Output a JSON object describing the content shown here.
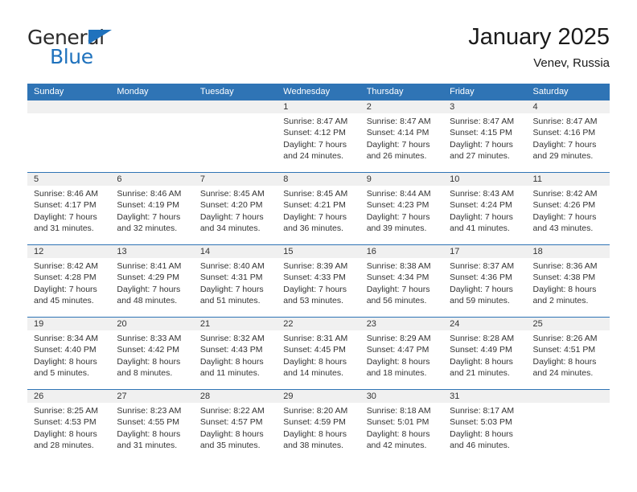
{
  "brand": {
    "name_part1": "General",
    "name_part2": "Blue",
    "accent_color": "#1f72bd"
  },
  "header": {
    "title": "January 2025",
    "subtitle": "Venev, Russia"
  },
  "theme": {
    "header_blue": "#2f74b5",
    "daynum_band": "#f0f0f0",
    "text": "#333333"
  },
  "weekdays": [
    "Sunday",
    "Monday",
    "Tuesday",
    "Wednesday",
    "Thursday",
    "Friday",
    "Saturday"
  ],
  "weeks": [
    [
      {
        "day": "",
        "lines": []
      },
      {
        "day": "",
        "lines": []
      },
      {
        "day": "",
        "lines": []
      },
      {
        "day": "1",
        "lines": [
          "Sunrise: 8:47 AM",
          "Sunset: 4:12 PM",
          "Daylight: 7 hours",
          "and 24 minutes."
        ]
      },
      {
        "day": "2",
        "lines": [
          "Sunrise: 8:47 AM",
          "Sunset: 4:14 PM",
          "Daylight: 7 hours",
          "and 26 minutes."
        ]
      },
      {
        "day": "3",
        "lines": [
          "Sunrise: 8:47 AM",
          "Sunset: 4:15 PM",
          "Daylight: 7 hours",
          "and 27 minutes."
        ]
      },
      {
        "day": "4",
        "lines": [
          "Sunrise: 8:47 AM",
          "Sunset: 4:16 PM",
          "Daylight: 7 hours",
          "and 29 minutes."
        ]
      }
    ],
    [
      {
        "day": "5",
        "lines": [
          "Sunrise: 8:46 AM",
          "Sunset: 4:17 PM",
          "Daylight: 7 hours",
          "and 31 minutes."
        ]
      },
      {
        "day": "6",
        "lines": [
          "Sunrise: 8:46 AM",
          "Sunset: 4:19 PM",
          "Daylight: 7 hours",
          "and 32 minutes."
        ]
      },
      {
        "day": "7",
        "lines": [
          "Sunrise: 8:45 AM",
          "Sunset: 4:20 PM",
          "Daylight: 7 hours",
          "and 34 minutes."
        ]
      },
      {
        "day": "8",
        "lines": [
          "Sunrise: 8:45 AM",
          "Sunset: 4:21 PM",
          "Daylight: 7 hours",
          "and 36 minutes."
        ]
      },
      {
        "day": "9",
        "lines": [
          "Sunrise: 8:44 AM",
          "Sunset: 4:23 PM",
          "Daylight: 7 hours",
          "and 39 minutes."
        ]
      },
      {
        "day": "10",
        "lines": [
          "Sunrise: 8:43 AM",
          "Sunset: 4:24 PM",
          "Daylight: 7 hours",
          "and 41 minutes."
        ]
      },
      {
        "day": "11",
        "lines": [
          "Sunrise: 8:42 AM",
          "Sunset: 4:26 PM",
          "Daylight: 7 hours",
          "and 43 minutes."
        ]
      }
    ],
    [
      {
        "day": "12",
        "lines": [
          "Sunrise: 8:42 AM",
          "Sunset: 4:28 PM",
          "Daylight: 7 hours",
          "and 45 minutes."
        ]
      },
      {
        "day": "13",
        "lines": [
          "Sunrise: 8:41 AM",
          "Sunset: 4:29 PM",
          "Daylight: 7 hours",
          "and 48 minutes."
        ]
      },
      {
        "day": "14",
        "lines": [
          "Sunrise: 8:40 AM",
          "Sunset: 4:31 PM",
          "Daylight: 7 hours",
          "and 51 minutes."
        ]
      },
      {
        "day": "15",
        "lines": [
          "Sunrise: 8:39 AM",
          "Sunset: 4:33 PM",
          "Daylight: 7 hours",
          "and 53 minutes."
        ]
      },
      {
        "day": "16",
        "lines": [
          "Sunrise: 8:38 AM",
          "Sunset: 4:34 PM",
          "Daylight: 7 hours",
          "and 56 minutes."
        ]
      },
      {
        "day": "17",
        "lines": [
          "Sunrise: 8:37 AM",
          "Sunset: 4:36 PM",
          "Daylight: 7 hours",
          "and 59 minutes."
        ]
      },
      {
        "day": "18",
        "lines": [
          "Sunrise: 8:36 AM",
          "Sunset: 4:38 PM",
          "Daylight: 8 hours",
          "and 2 minutes."
        ]
      }
    ],
    [
      {
        "day": "19",
        "lines": [
          "Sunrise: 8:34 AM",
          "Sunset: 4:40 PM",
          "Daylight: 8 hours",
          "and 5 minutes."
        ]
      },
      {
        "day": "20",
        "lines": [
          "Sunrise: 8:33 AM",
          "Sunset: 4:42 PM",
          "Daylight: 8 hours",
          "and 8 minutes."
        ]
      },
      {
        "day": "21",
        "lines": [
          "Sunrise: 8:32 AM",
          "Sunset: 4:43 PM",
          "Daylight: 8 hours",
          "and 11 minutes."
        ]
      },
      {
        "day": "22",
        "lines": [
          "Sunrise: 8:31 AM",
          "Sunset: 4:45 PM",
          "Daylight: 8 hours",
          "and 14 minutes."
        ]
      },
      {
        "day": "23",
        "lines": [
          "Sunrise: 8:29 AM",
          "Sunset: 4:47 PM",
          "Daylight: 8 hours",
          "and 18 minutes."
        ]
      },
      {
        "day": "24",
        "lines": [
          "Sunrise: 8:28 AM",
          "Sunset: 4:49 PM",
          "Daylight: 8 hours",
          "and 21 minutes."
        ]
      },
      {
        "day": "25",
        "lines": [
          "Sunrise: 8:26 AM",
          "Sunset: 4:51 PM",
          "Daylight: 8 hours",
          "and 24 minutes."
        ]
      }
    ],
    [
      {
        "day": "26",
        "lines": [
          "Sunrise: 8:25 AM",
          "Sunset: 4:53 PM",
          "Daylight: 8 hours",
          "and 28 minutes."
        ]
      },
      {
        "day": "27",
        "lines": [
          "Sunrise: 8:23 AM",
          "Sunset: 4:55 PM",
          "Daylight: 8 hours",
          "and 31 minutes."
        ]
      },
      {
        "day": "28",
        "lines": [
          "Sunrise: 8:22 AM",
          "Sunset: 4:57 PM",
          "Daylight: 8 hours",
          "and 35 minutes."
        ]
      },
      {
        "day": "29",
        "lines": [
          "Sunrise: 8:20 AM",
          "Sunset: 4:59 PM",
          "Daylight: 8 hours",
          "and 38 minutes."
        ]
      },
      {
        "day": "30",
        "lines": [
          "Sunrise: 8:18 AM",
          "Sunset: 5:01 PM",
          "Daylight: 8 hours",
          "and 42 minutes."
        ]
      },
      {
        "day": "31",
        "lines": [
          "Sunrise: 8:17 AM",
          "Sunset: 5:03 PM",
          "Daylight: 8 hours",
          "and 46 minutes."
        ]
      },
      {
        "day": "",
        "lines": []
      }
    ]
  ]
}
